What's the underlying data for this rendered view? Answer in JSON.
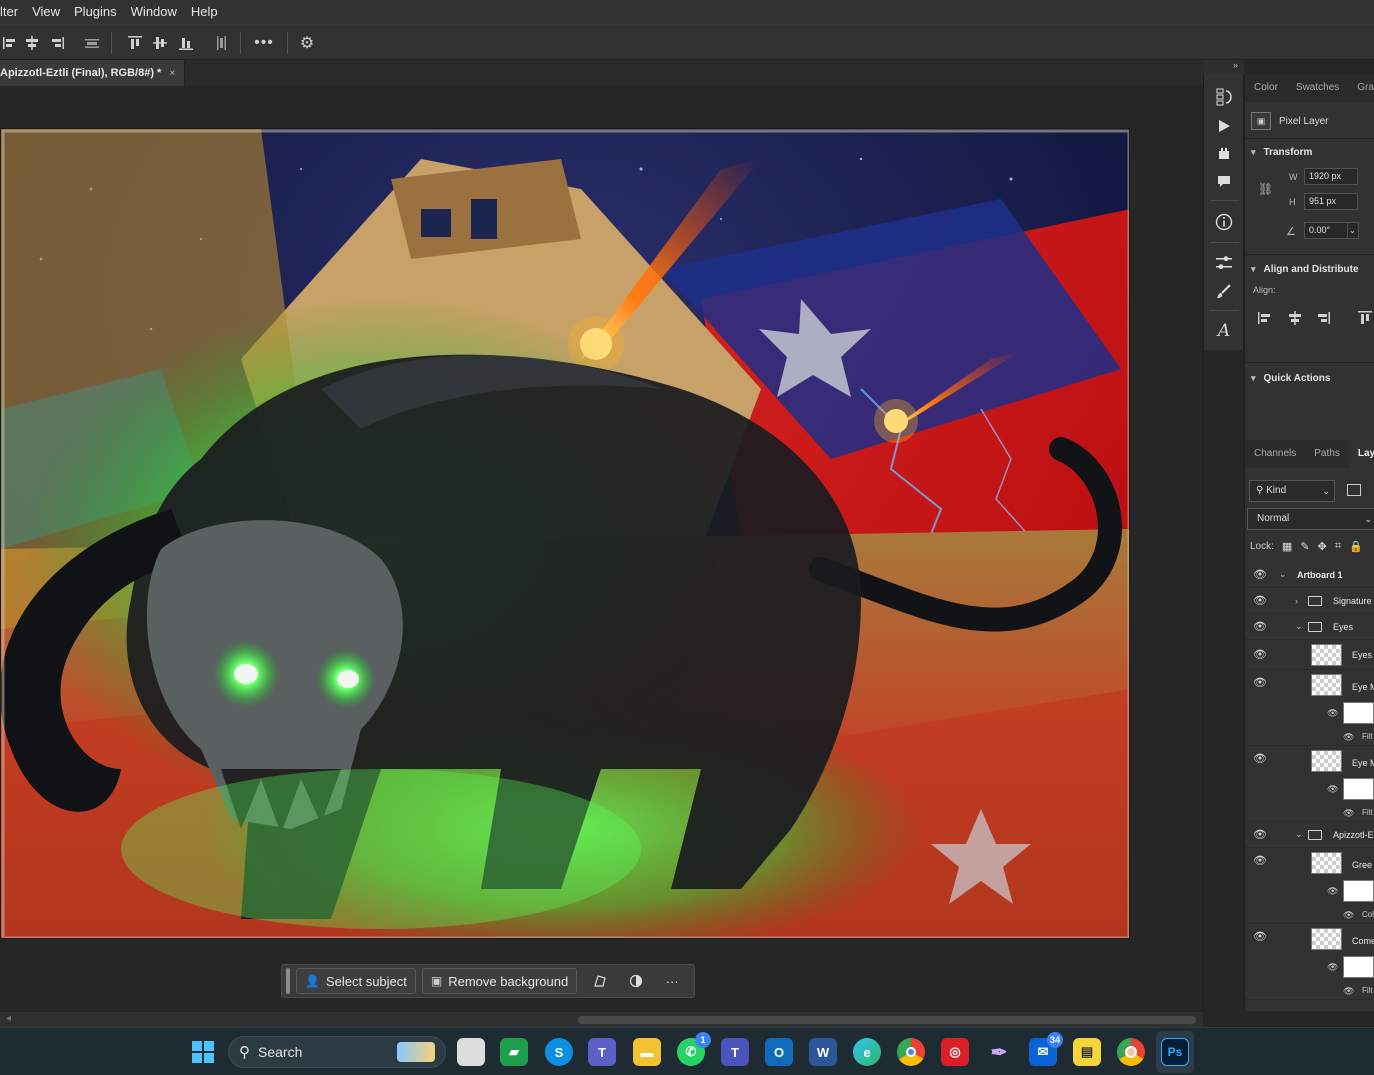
{
  "menu": {
    "items": [
      "lter",
      "View",
      "Plugins",
      "Window",
      "Help"
    ]
  },
  "options_bar": {
    "icons": [
      "align-left-edges-icon",
      "align-horizontal-centers-icon",
      "align-right-edges-icon",
      "distribute-icon",
      "align-top-edges-icon",
      "align-vertical-centers-icon",
      "align-bottom-edges-icon",
      "distribute-vertical-icon",
      "more-options-icon",
      "gear-icon"
    ]
  },
  "document": {
    "tab_label": "Apizzotl-Eztli (Final), RGB/8#) *",
    "close_glyph": "×"
  },
  "contextual_taskbar": {
    "select_subject": "Select subject",
    "remove_background": "Remove background",
    "more": "···"
  },
  "right_tools": {
    "collapse": "»"
  },
  "properties": {
    "tabs": [
      "Color",
      "Swatches",
      "Gra"
    ],
    "layer_kind": "Pixel Layer",
    "transform": {
      "title": "Transform",
      "w_label": "W",
      "w_value": "1920 px",
      "h_label": "H",
      "h_value": "951 px",
      "angle_value": "0.00°"
    },
    "align": {
      "title": "Align and Distribute",
      "align_label": "Align:"
    },
    "quick_actions": {
      "title": "Quick Actions"
    }
  },
  "layers_panel": {
    "tabs": [
      "Channels",
      "Paths",
      "Lay"
    ],
    "kind_filter": "Kind",
    "blend_mode": "Normal",
    "lock_label": "Lock:",
    "layers": [
      {
        "name": "Artboard 1",
        "type": "artboard"
      },
      {
        "name": "Signature",
        "type": "group-collapsed"
      },
      {
        "name": "Eyes",
        "type": "group-expanded"
      },
      {
        "name": "Eyes",
        "type": "layer"
      },
      {
        "name": "Eye M",
        "type": "smart-layer",
        "filter": "Filt"
      },
      {
        "name": "Eye M",
        "type": "smart-layer",
        "filter": "Filt"
      },
      {
        "name": "Apizzotl-E",
        "type": "group-expanded"
      },
      {
        "name": "Gree",
        "type": "smart-layer",
        "filter": "Col"
      },
      {
        "name": "Come",
        "type": "smart-layer",
        "filter": "Filt"
      }
    ]
  },
  "windows_taskbar": {
    "search_label": "Search",
    "apps": [
      {
        "name": "start-icon",
        "badge": ""
      },
      {
        "name": "task-view-icon",
        "badge": ""
      },
      {
        "name": "chat-icon",
        "badge": ""
      },
      {
        "name": "skype-icon",
        "badge": ""
      },
      {
        "name": "teams-icon",
        "badge": ""
      },
      {
        "name": "file-explorer-icon",
        "badge": ""
      },
      {
        "name": "whatsapp-icon",
        "badge": "1"
      },
      {
        "name": "teams-classic-icon",
        "badge": ""
      },
      {
        "name": "outlook-icon",
        "badge": ""
      },
      {
        "name": "word-icon",
        "badge": ""
      },
      {
        "name": "edge-icon",
        "badge": ""
      },
      {
        "name": "chrome-icon",
        "badge": ""
      },
      {
        "name": "creative-cloud-icon",
        "badge": ""
      },
      {
        "name": "feather-app-icon",
        "badge": ""
      },
      {
        "name": "mail-icon",
        "badge": "34"
      },
      {
        "name": "sticky-notes-icon",
        "badge": ""
      },
      {
        "name": "chrome-profile-icon",
        "badge": ""
      },
      {
        "name": "photoshop-icon",
        "badge": ""
      }
    ]
  },
  "colors": {
    "app_bg": "#262626",
    "panel_bg": "#323232",
    "accent_blue": "#3b82f6",
    "glow_green": "#3fe05a",
    "flag_red": "#c8141a"
  }
}
